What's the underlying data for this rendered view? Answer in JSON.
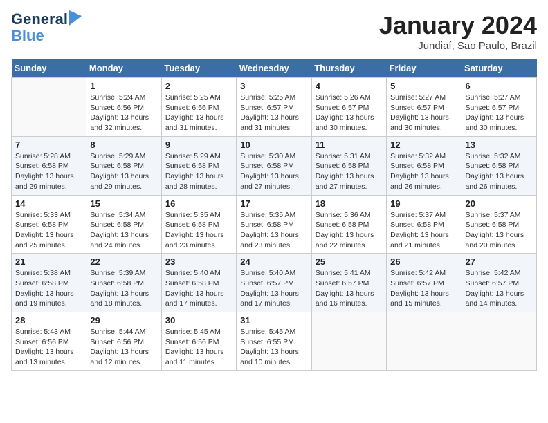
{
  "header": {
    "logo_line1": "General",
    "logo_line2": "Blue",
    "month_title": "January 2024",
    "subtitle": "Jundiaí, Sao Paulo, Brazil"
  },
  "days_of_week": [
    "Sunday",
    "Monday",
    "Tuesday",
    "Wednesday",
    "Thursday",
    "Friday",
    "Saturday"
  ],
  "weeks": [
    [
      {
        "num": "",
        "detail": ""
      },
      {
        "num": "1",
        "detail": "Sunrise: 5:24 AM\nSunset: 6:56 PM\nDaylight: 13 hours\nand 32 minutes."
      },
      {
        "num": "2",
        "detail": "Sunrise: 5:25 AM\nSunset: 6:56 PM\nDaylight: 13 hours\nand 31 minutes."
      },
      {
        "num": "3",
        "detail": "Sunrise: 5:25 AM\nSunset: 6:57 PM\nDaylight: 13 hours\nand 31 minutes."
      },
      {
        "num": "4",
        "detail": "Sunrise: 5:26 AM\nSunset: 6:57 PM\nDaylight: 13 hours\nand 30 minutes."
      },
      {
        "num": "5",
        "detail": "Sunrise: 5:27 AM\nSunset: 6:57 PM\nDaylight: 13 hours\nand 30 minutes."
      },
      {
        "num": "6",
        "detail": "Sunrise: 5:27 AM\nSunset: 6:57 PM\nDaylight: 13 hours\nand 30 minutes."
      }
    ],
    [
      {
        "num": "7",
        "detail": "Sunrise: 5:28 AM\nSunset: 6:58 PM\nDaylight: 13 hours\nand 29 minutes."
      },
      {
        "num": "8",
        "detail": "Sunrise: 5:29 AM\nSunset: 6:58 PM\nDaylight: 13 hours\nand 29 minutes."
      },
      {
        "num": "9",
        "detail": "Sunrise: 5:29 AM\nSunset: 6:58 PM\nDaylight: 13 hours\nand 28 minutes."
      },
      {
        "num": "10",
        "detail": "Sunrise: 5:30 AM\nSunset: 6:58 PM\nDaylight: 13 hours\nand 27 minutes."
      },
      {
        "num": "11",
        "detail": "Sunrise: 5:31 AM\nSunset: 6:58 PM\nDaylight: 13 hours\nand 27 minutes."
      },
      {
        "num": "12",
        "detail": "Sunrise: 5:32 AM\nSunset: 6:58 PM\nDaylight: 13 hours\nand 26 minutes."
      },
      {
        "num": "13",
        "detail": "Sunrise: 5:32 AM\nSunset: 6:58 PM\nDaylight: 13 hours\nand 26 minutes."
      }
    ],
    [
      {
        "num": "14",
        "detail": "Sunrise: 5:33 AM\nSunset: 6:58 PM\nDaylight: 13 hours\nand 25 minutes."
      },
      {
        "num": "15",
        "detail": "Sunrise: 5:34 AM\nSunset: 6:58 PM\nDaylight: 13 hours\nand 24 minutes."
      },
      {
        "num": "16",
        "detail": "Sunrise: 5:35 AM\nSunset: 6:58 PM\nDaylight: 13 hours\nand 23 minutes."
      },
      {
        "num": "17",
        "detail": "Sunrise: 5:35 AM\nSunset: 6:58 PM\nDaylight: 13 hours\nand 23 minutes."
      },
      {
        "num": "18",
        "detail": "Sunrise: 5:36 AM\nSunset: 6:58 PM\nDaylight: 13 hours\nand 22 minutes."
      },
      {
        "num": "19",
        "detail": "Sunrise: 5:37 AM\nSunset: 6:58 PM\nDaylight: 13 hours\nand 21 minutes."
      },
      {
        "num": "20",
        "detail": "Sunrise: 5:37 AM\nSunset: 6:58 PM\nDaylight: 13 hours\nand 20 minutes."
      }
    ],
    [
      {
        "num": "21",
        "detail": "Sunrise: 5:38 AM\nSunset: 6:58 PM\nDaylight: 13 hours\nand 19 minutes."
      },
      {
        "num": "22",
        "detail": "Sunrise: 5:39 AM\nSunset: 6:58 PM\nDaylight: 13 hours\nand 18 minutes."
      },
      {
        "num": "23",
        "detail": "Sunrise: 5:40 AM\nSunset: 6:58 PM\nDaylight: 13 hours\nand 17 minutes."
      },
      {
        "num": "24",
        "detail": "Sunrise: 5:40 AM\nSunset: 6:57 PM\nDaylight: 13 hours\nand 17 minutes."
      },
      {
        "num": "25",
        "detail": "Sunrise: 5:41 AM\nSunset: 6:57 PM\nDaylight: 13 hours\nand 16 minutes."
      },
      {
        "num": "26",
        "detail": "Sunrise: 5:42 AM\nSunset: 6:57 PM\nDaylight: 13 hours\nand 15 minutes."
      },
      {
        "num": "27",
        "detail": "Sunrise: 5:42 AM\nSunset: 6:57 PM\nDaylight: 13 hours\nand 14 minutes."
      }
    ],
    [
      {
        "num": "28",
        "detail": "Sunrise: 5:43 AM\nSunset: 6:56 PM\nDaylight: 13 hours\nand 13 minutes."
      },
      {
        "num": "29",
        "detail": "Sunrise: 5:44 AM\nSunset: 6:56 PM\nDaylight: 13 hours\nand 12 minutes."
      },
      {
        "num": "30",
        "detail": "Sunrise: 5:45 AM\nSunset: 6:56 PM\nDaylight: 13 hours\nand 11 minutes."
      },
      {
        "num": "31",
        "detail": "Sunrise: 5:45 AM\nSunset: 6:55 PM\nDaylight: 13 hours\nand 10 minutes."
      },
      {
        "num": "",
        "detail": ""
      },
      {
        "num": "",
        "detail": ""
      },
      {
        "num": "",
        "detail": ""
      }
    ]
  ]
}
